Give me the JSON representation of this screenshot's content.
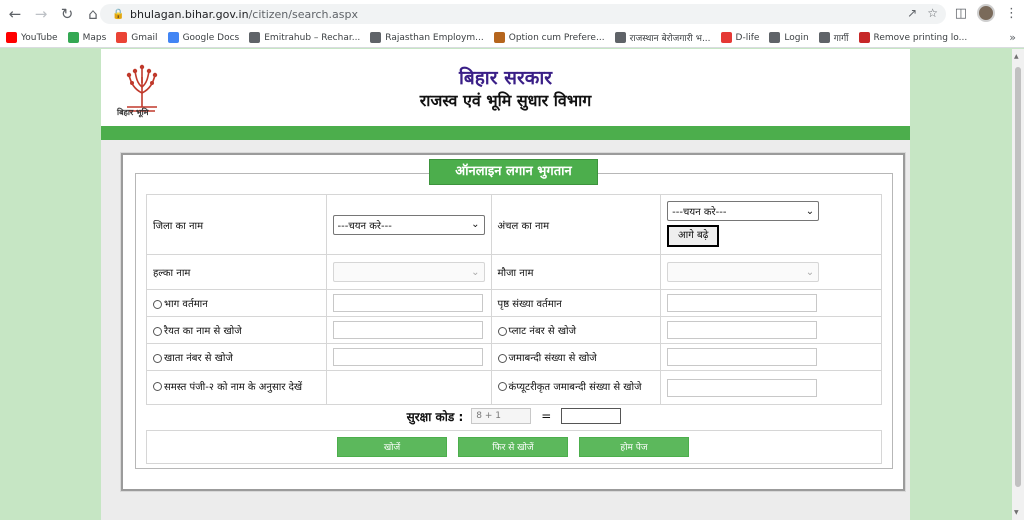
{
  "browser": {
    "url_host": "bhulagan.bihar.gov.in",
    "url_path": "/citizen/search.aspx",
    "bookmarks": [
      {
        "label": "YouTube",
        "icon": "youtube-icon",
        "color": "#ff0000"
      },
      {
        "label": "Maps",
        "icon": "maps-icon",
        "color": "#34a853"
      },
      {
        "label": "Gmail",
        "icon": "gmail-icon",
        "color": "#ea4335"
      },
      {
        "label": "Google Docs",
        "icon": "docs-icon",
        "color": "#4285f4"
      },
      {
        "label": "Emitrahub – Rechar...",
        "icon": "globe-icon",
        "color": "#5f6368"
      },
      {
        "label": "Rajasthan Employm...",
        "icon": "globe-icon",
        "color": "#5f6368"
      },
      {
        "label": "Option cum Prefere...",
        "icon": "emblem-icon",
        "color": "#b5651d"
      },
      {
        "label": "राजस्थान बेरोजगारी भ...",
        "icon": "bulb-icon",
        "color": "#5f6368"
      },
      {
        "label": "D-life",
        "icon": "dlife-icon",
        "color": "#e53935"
      },
      {
        "label": "Login",
        "icon": "globe-icon",
        "color": "#5f6368"
      },
      {
        "label": "गार्गी",
        "icon": "globe-icon",
        "color": "#5f6368"
      },
      {
        "label": "Remove printing lo...",
        "icon": "pdf-icon",
        "color": "#c62828"
      }
    ],
    "more": "»"
  },
  "header": {
    "logo_caption": "बिहार भूमि",
    "gov_title": "बिहार सरकार",
    "dept_title": "राजस्व एवं भूमि सुधार विभाग"
  },
  "panel": {
    "title": "ऑनलाइन लगान भुगतान",
    "district_label": "जिला का नाम",
    "district_select": "---चयन करे---",
    "circle_label": "अंचल का नाम",
    "circle_select": "---चयन करे---",
    "next_button": "आगे बढ़े",
    "halka_label": "हल्का नाम",
    "mauja_label": "मौजा नाम",
    "bhag_label": "भाग वर्तमान",
    "page_label": "पृष्ठ संख्या वर्तमान",
    "raiyat_label": "रैयत का नाम से खोजे",
    "plot_label": "प्लाट नंबर से खोजे",
    "khata_label": "खाता नंबर से खोजे",
    "jamabandi_label": "जमाबन्दी संख्या से खोजे",
    "panji_label": "समस्त पंजी-२ को नाम के अनुसार देखें",
    "computer_label": "कंप्यूटरीकृत जमाबन्दी संख्या से खोजे",
    "captcha_label": "सुरक्षा कोड :",
    "captcha_value": "8 + 1",
    "captcha_equals": "=",
    "search_button": "खोजें",
    "research_button": "फिर से खोजें",
    "home_button": "होम पेज"
  }
}
